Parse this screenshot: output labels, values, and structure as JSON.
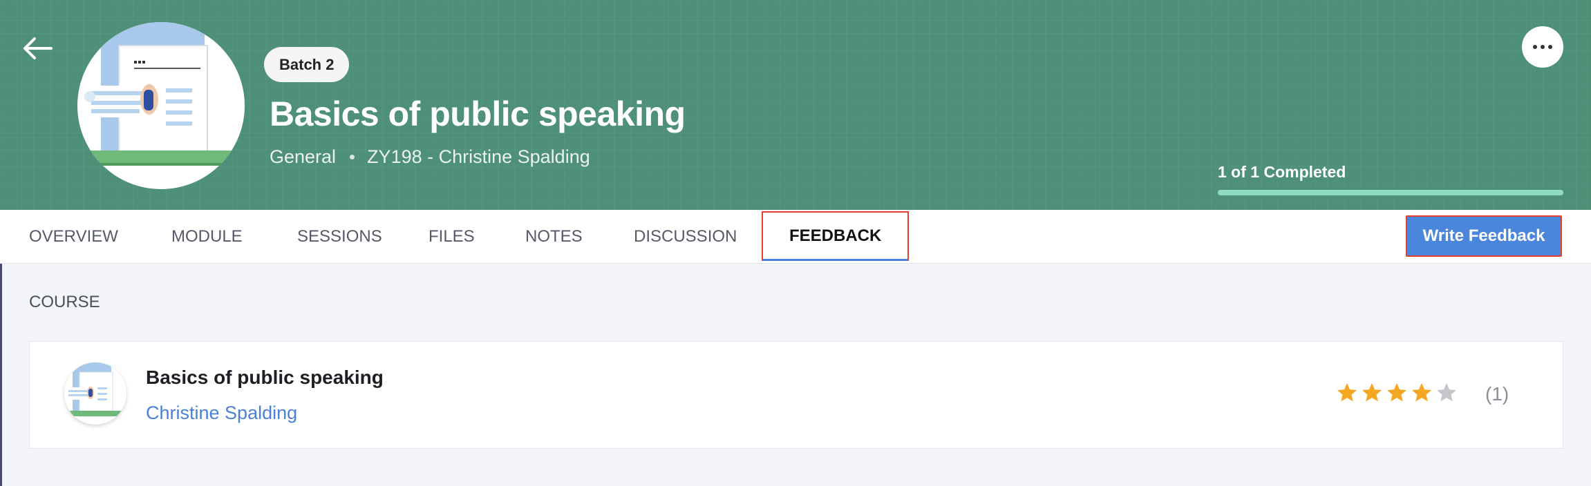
{
  "header": {
    "batch": "Batch 2",
    "title": "Basics of public speaking",
    "category": "General",
    "course_meta": "ZY198 - Christine Spalding",
    "progress_text": "1 of 1 Completed",
    "progress_fraction": 1.0,
    "accent_color": "#4f9178"
  },
  "icons": {
    "back": "arrow-left-icon",
    "more": "more-horizontal-icon",
    "star": "star-icon"
  },
  "tabs": [
    {
      "label": "OVERVIEW"
    },
    {
      "label": "MODULE"
    },
    {
      "label": "SESSIONS"
    },
    {
      "label": "FILES"
    },
    {
      "label": "NOTES"
    },
    {
      "label": "DISCUSSION"
    },
    {
      "label": "FEEDBACK",
      "active": true
    }
  ],
  "actions": {
    "write_feedback": "Write Feedback"
  },
  "content": {
    "section_label": "COURSE",
    "card": {
      "title": "Basics of public speaking",
      "author": "Christine Spalding",
      "rating": 4,
      "rating_max": 5,
      "rating_count": "(1)"
    }
  }
}
